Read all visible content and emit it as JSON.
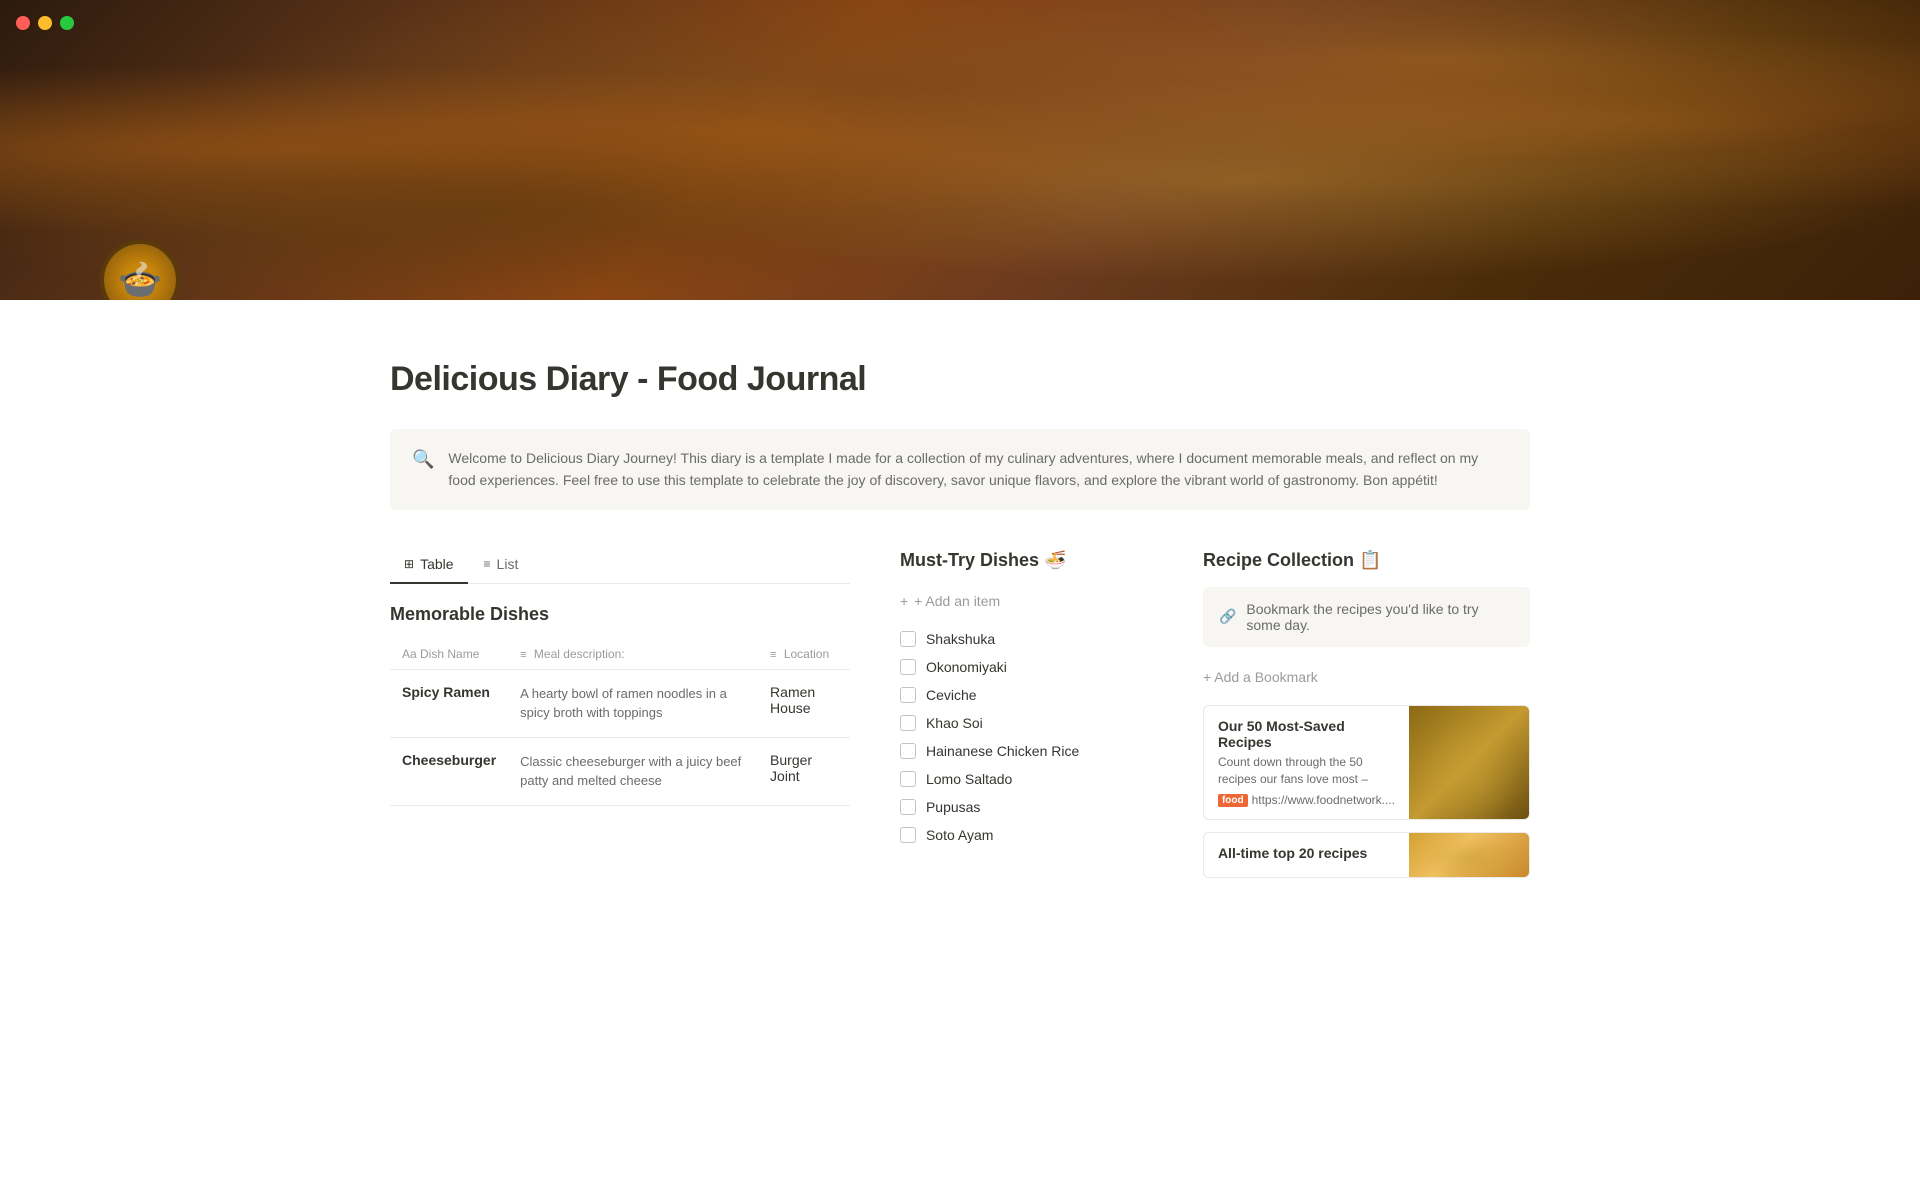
{
  "traffic_lights": {
    "red": "#ff5f56",
    "yellow": "#ffbd2e",
    "green": "#27c93f"
  },
  "page_title": "Delicious Diary - Food Journal",
  "info_box": {
    "icon": "🔍",
    "text": "Welcome to Delicious Diary Journey! This diary is a template I made for a collection of my culinary adventures, where I document memorable meals, and reflect on my food experiences. Feel free to use this template to celebrate the joy of discovery, savor unique flavors, and explore the vibrant world of gastronomy. Bon appétit!"
  },
  "table_section": {
    "title": "Memorable Dishes",
    "tabs": [
      {
        "label": "Table",
        "icon": "⊞",
        "active": true
      },
      {
        "label": "List",
        "icon": "≡",
        "active": false
      }
    ],
    "columns": [
      {
        "label": "Dish Name",
        "prefix": "Aa",
        "icon": ""
      },
      {
        "label": "Meal description:",
        "icon": "≡"
      },
      {
        "label": "Location",
        "icon": "≡"
      }
    ],
    "rows": [
      {
        "dish_name": "Spicy Ramen",
        "description": "A hearty bowl of ramen noodles in a spicy broth with toppings",
        "location": "Ramen House"
      },
      {
        "dish_name": "Cheeseburger",
        "description": "Classic cheeseburger with a juicy beef patty and melted cheese",
        "location": "Burger Joint"
      }
    ]
  },
  "must_try": {
    "title": "Must-Try Dishes 🍜",
    "add_label": "+ Add an item",
    "items": [
      "Shakshuka",
      "Okonomiyaki",
      "Ceviche",
      "Khao Soi",
      "Hainanese Chicken Rice",
      "Lomo Saltado",
      "Pupusas",
      "Soto Ayam"
    ]
  },
  "recipe_collection": {
    "title": "Recipe Collection 📋",
    "info_text": "Bookmark the recipes you'd like to try some day.",
    "info_icon": "🔗",
    "add_bookmark_label": "+ Add a Bookmark",
    "recipes": [
      {
        "title": "Our 50 Most-Saved Recipes",
        "description": "Count down through the 50 recipes our fans love most –",
        "link": "https://www.foodnetwork....",
        "logo": "food"
      },
      {
        "title": "All-time top 20 recipes",
        "description": "",
        "link": "",
        "logo": ""
      }
    ]
  }
}
